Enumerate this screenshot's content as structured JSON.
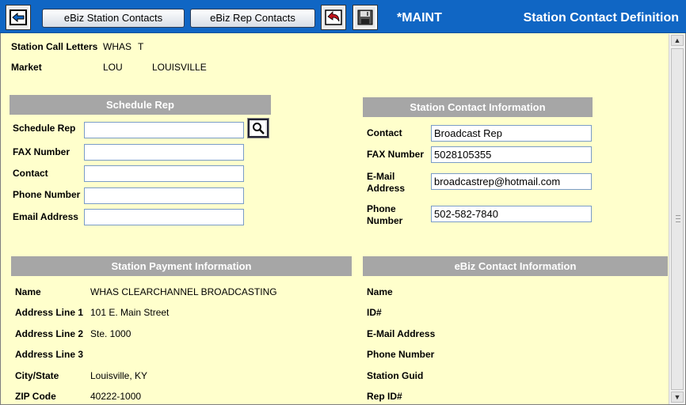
{
  "toolbar": {
    "back_icon": "back-arrow-icon",
    "station_contacts_label": "eBiz Station Contacts",
    "rep_contacts_label": "eBiz Rep Contacts",
    "undo_icon": "undo-icon",
    "save_icon": "save-icon",
    "mode": "*MAINT",
    "title": "Station Contact Definition",
    "accent_color": "#1066c4"
  },
  "station": {
    "call_letters_label": "Station Call Letters",
    "call_letters": "WHAS",
    "call_suffix": "T",
    "market_label": "Market",
    "market_code": "LOU",
    "market_name": "LOUISVILLE"
  },
  "schedule_rep": {
    "header": "Schedule Rep",
    "rep_label": "Schedule Rep",
    "rep_value": "",
    "fax_label": "FAX Number",
    "fax_value": "",
    "contact_label": "Contact",
    "contact_value": "",
    "phone_label": "Phone Number",
    "phone_value": "",
    "email_label": "Email Address",
    "email_value": ""
  },
  "station_contact": {
    "header": "Station Contact Information",
    "contact_label": "Contact",
    "contact_value": "Broadcast Rep",
    "fax_label": "FAX Number",
    "fax_value": "5028105355",
    "email_label_1": "E-Mail",
    "email_label_2": "Address",
    "email_value": "broadcastrep@hotmail.com",
    "phone_label_1": "Phone",
    "phone_label_2": "Number",
    "phone_value": "502-582-7840"
  },
  "payment": {
    "header": "Station Payment Information",
    "name_label": "Name",
    "name_value": "WHAS CLEARCHANNEL BROADCASTING",
    "addr1_label": "Address Line 1",
    "addr1_value": "101 E. Main Street",
    "addr2_label": "Address Line 2",
    "addr2_value": "Ste. 1000",
    "addr3_label": "Address Line 3",
    "addr3_value": "",
    "citystate_label": "City/State",
    "citystate_value": "Louisville, KY",
    "zip_label": "ZIP Code",
    "zip_value": "40222-1000"
  },
  "ebiz_contact": {
    "header": "eBiz Contact Information",
    "name_label": "Name",
    "id_label": "ID#",
    "email_label": "E-Mail Address",
    "phone_label": "Phone Number",
    "guid_label": "Station Guid",
    "rep_id_label": "Rep ID#"
  }
}
